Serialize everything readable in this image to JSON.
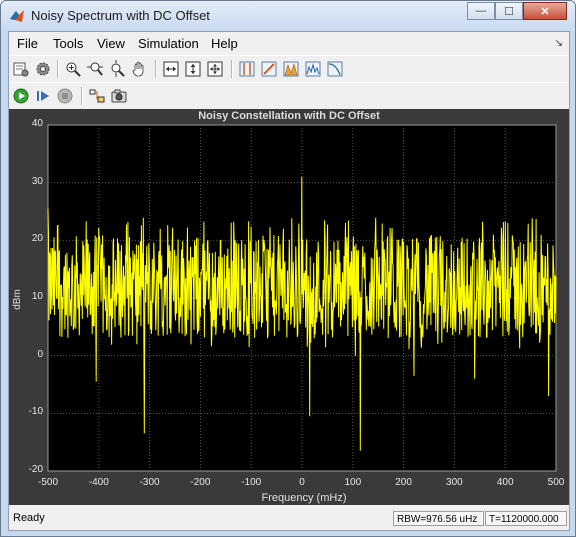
{
  "window": {
    "title": "Noisy Spectrum with DC Offset",
    "minimize": "—",
    "maximize": "☐",
    "close": "✕"
  },
  "menu": {
    "items": [
      "File",
      "Tools",
      "View",
      "Simulation",
      "Help"
    ],
    "dock_arrow": "↘"
  },
  "toolbar1": [
    "scope-parameters",
    "configuration",
    "zoom-in",
    "zoom-x",
    "zoom-y",
    "pan",
    "scale-axes",
    "scale-y-axis",
    "autoscale",
    "cursor-measurements",
    "signal-statistics",
    "peak-finder",
    "distortion-measurements",
    "ccdf-measurements"
  ],
  "toolbar2": [
    "run",
    "step-forward",
    "stop",
    "highlight-simulink-block",
    "snapshot"
  ],
  "plot": {
    "title": "Noisy Constellation with DC Offset",
    "ylabel": "dBm",
    "xlabel": "Frequency (mHz)",
    "y_ticks": [
      "40",
      "30",
      "20",
      "10",
      "0",
      "-10",
      "-20"
    ],
    "x_ticks": [
      "-500",
      "-400",
      "-300",
      "-200",
      "-100",
      "0",
      "100",
      "200",
      "300",
      "400",
      "500"
    ]
  },
  "chart_data": {
    "type": "line",
    "title": "Noisy Constellation with DC Offset",
    "xlabel": "Frequency (mHz)",
    "ylabel": "dBm",
    "xlim": [
      -500,
      500
    ],
    "ylim": [
      -20,
      40
    ],
    "grid": true,
    "series": [
      {
        "color": "#ffff00",
        "noise_floor_dbm": 12,
        "noise_band_dbm": [
          4,
          22
        ],
        "peaks": [
          {
            "x": 0,
            "y": 31
          },
          {
            "x": -500,
            "y": 25.5
          },
          {
            "x": -310,
            "y": -13.5
          },
          {
            "x": 15,
            "y": -10.5
          },
          {
            "x": 115,
            "y": -16.5
          },
          {
            "x": -405,
            "y": -4.5
          },
          {
            "x": 220,
            "y": -3.5
          },
          {
            "x": 340,
            "y": -4
          },
          {
            "x": 485,
            "y": -7
          },
          {
            "x": 105,
            "y": 0
          }
        ]
      }
    ],
    "colors": {
      "background": "#000000",
      "axes": "#3a3a3a",
      "grid": "#5a5a5a",
      "line": "#ffff00"
    }
  },
  "status": {
    "ready": "Ready",
    "rbw": "RBW=976.56 uHz",
    "time": "T=1120000.000"
  }
}
